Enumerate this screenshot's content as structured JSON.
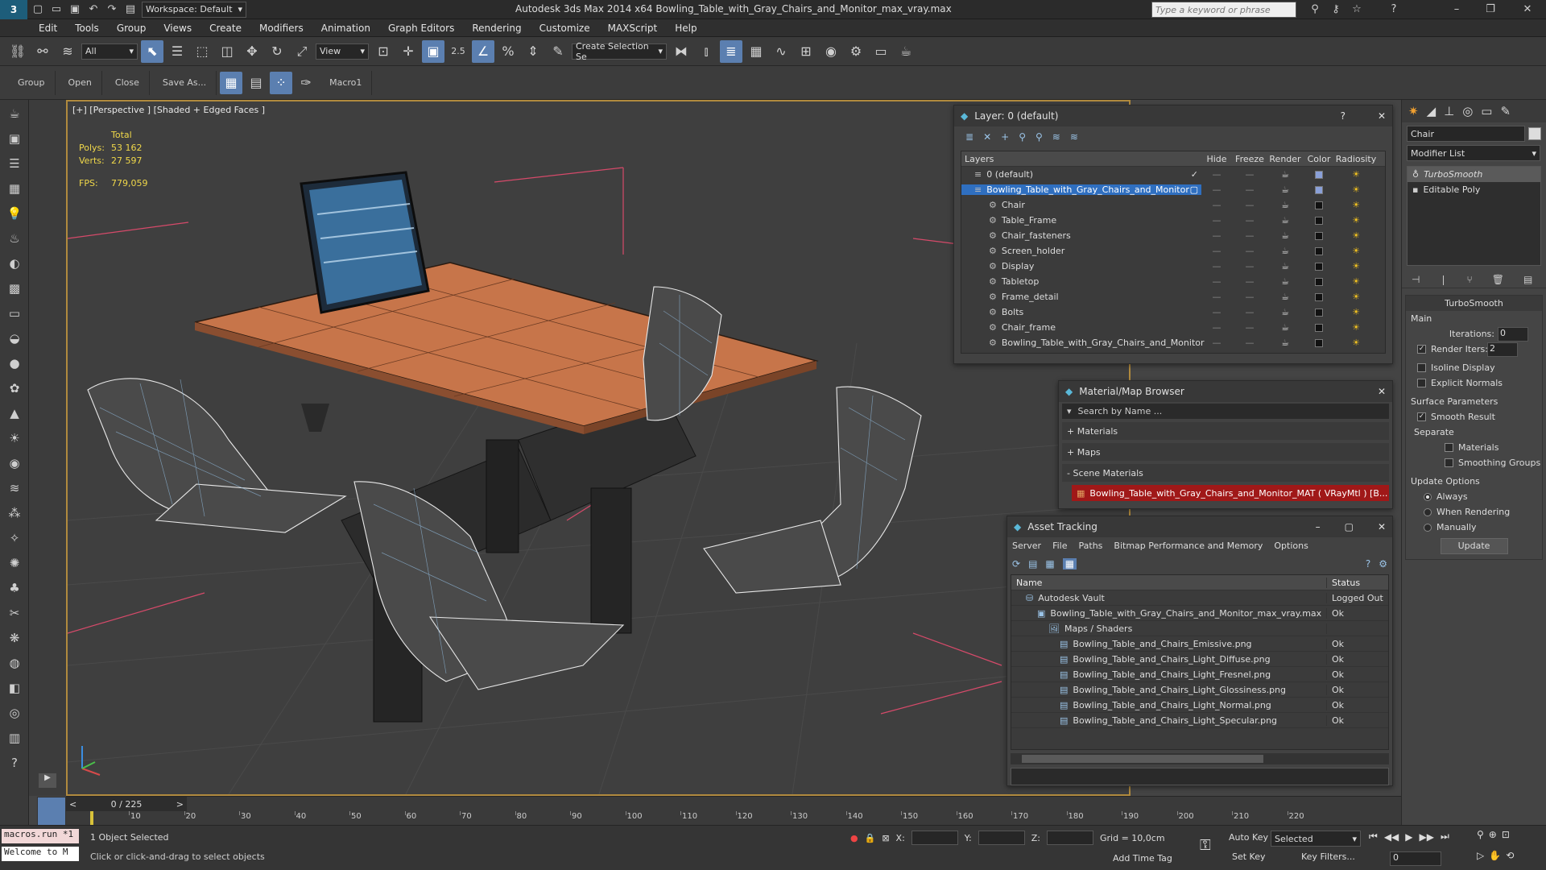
{
  "window": {
    "workspace": "Workspace: Default",
    "title": "Autodesk 3ds Max  2014 x64     Bowling_Table_with_Gray_Chairs_and_Monitor_max_vray.max",
    "search_placeholder": "Type a keyword or phrase"
  },
  "menu": [
    "Edit",
    "Tools",
    "Group",
    "Views",
    "Create",
    "Modifiers",
    "Animation",
    "Graph Editors",
    "Rendering",
    "Customize",
    "MAXScript",
    "Help"
  ],
  "toolbar": {
    "filter": "All",
    "refcoord": "View",
    "snap_value": "2.5",
    "selection_set": "Create Selection Se"
  },
  "ribbon": {
    "group": "Group",
    "open": "Open",
    "close": "Close",
    "save_as": "Save As...",
    "macro": "Macro1"
  },
  "viewport": {
    "label": "[+] [Perspective ] [Shaded + Edged Faces ]",
    "total": "Total",
    "polys_label": "Polys:",
    "polys": "53 162",
    "verts_label": "Verts:",
    "verts": "27 597",
    "fps_label": "FPS:",
    "fps": "779,059"
  },
  "layers": {
    "title": "Layer: 0 (default)",
    "columns": [
      "Layers",
      "Hide",
      "Freeze",
      "Render",
      "Color",
      "Radiosity"
    ],
    "rows": [
      "0 (default)",
      "Bowling_Table_with_Gray_Chairs_and_Monitor",
      "Chair",
      "Table_Frame",
      "Chair_fasteners",
      "Screen_holder",
      "Display",
      "Tabletop",
      "Frame_detail",
      "Bolts",
      "Chair_frame",
      "Bowling_Table_with_Gray_Chairs_and_Monitor"
    ]
  },
  "material_browser": {
    "title": "Material/Map Browser",
    "search": "Search by Name ...",
    "materials": "+ Materials",
    "maps": "+ Maps",
    "scene": "- Scene Materials",
    "item": "Bowling_Table_with_Gray_Chairs_and_Monitor_MAT ( VRayMtl ) [B..."
  },
  "asset_tracking": {
    "title": "Asset Tracking",
    "menu": [
      "Server",
      "File",
      "Paths",
      "Bitmap Performance and Memory",
      "Options"
    ],
    "col_name": "Name",
    "col_status": "Status",
    "rows": [
      {
        "name": "Autodesk Vault",
        "status": "Logged Out"
      },
      {
        "name": "Bowling_Table_with_Gray_Chairs_and_Monitor_max_vray.max",
        "status": "Ok"
      },
      {
        "name": "Maps / Shaders",
        "status": ""
      },
      {
        "name": "Bowling_Table_and_Chairs_Emissive.png",
        "status": "Ok"
      },
      {
        "name": "Bowling_Table_and_Chairs_Light_Diffuse.png",
        "status": "Ok"
      },
      {
        "name": "Bowling_Table_and_Chairs_Light_Fresnel.png",
        "status": "Ok"
      },
      {
        "name": "Bowling_Table_and_Chairs_Light_Glossiness.png",
        "status": "Ok"
      },
      {
        "name": "Bowling_Table_and_Chairs_Light_Normal.png",
        "status": "Ok"
      },
      {
        "name": "Bowling_Table_and_Chairs_Light_Specular.png",
        "status": "Ok"
      }
    ]
  },
  "command_panel": {
    "object_name": "Chair",
    "modifier_list": "Modifier List",
    "stack": [
      "TurboSmooth",
      "Editable Poly"
    ],
    "turbosmooth": "TurboSmooth",
    "main": "Main",
    "iterations_label": "Iterations:",
    "iterations": "0",
    "render_iters_label": "Render Iters:",
    "render_iters": "2",
    "isoline": "Isoline Display",
    "explicit": "Explicit Normals",
    "surface": "Surface Parameters",
    "smooth_result": "Smooth Result",
    "separate": "Separate",
    "materials": "Materials",
    "smoothing_groups": "Smoothing Groups",
    "update_options": "Update Options",
    "always": "Always",
    "when_rendering": "When Rendering",
    "manually": "Manually",
    "update": "Update"
  },
  "timeline": {
    "frame": "0 / 225",
    "ticks": [
      "10",
      "20",
      "30",
      "40",
      "50",
      "60",
      "70",
      "80",
      "90",
      "100",
      "110",
      "120",
      "130",
      "140",
      "150",
      "160",
      "170",
      "180",
      "190",
      "200",
      "210",
      "220"
    ]
  },
  "status": {
    "macro1": "macros.run *1",
    "macro2": "Welcome to M",
    "selected": "1 Object Selected",
    "hint": "Click or click-and-drag to select objects",
    "x": "X:",
    "y": "Y:",
    "z": "Z:",
    "grid": "Grid = 10,0cm",
    "auto_key": "Auto Key",
    "selected_mode": "Selected",
    "set_key": "Set Key",
    "key_filters": "Key Filters...",
    "add_time_tag": "Add Time Tag",
    "frame_field": "0"
  }
}
